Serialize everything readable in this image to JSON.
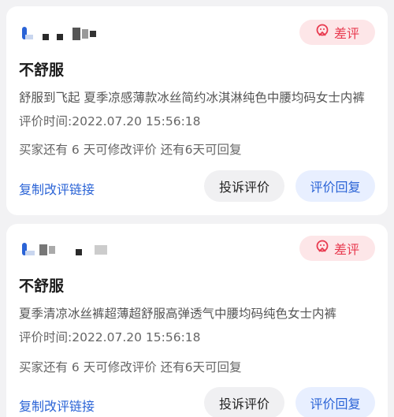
{
  "colors": {
    "accent_blue": "#2a63d6",
    "badge_red": "#e83a4f",
    "badge_bg": "#fde6e8",
    "reply_bg": "#e8efff",
    "complain_bg": "#f0f0f2"
  },
  "reviews": [
    {
      "badge_label": "差评",
      "badge_icon": "thumbs-down-face-icon",
      "title": "不舒服",
      "product": "舒服到飞起 夏季凉感薄款冰丝简约冰淇淋纯色中腰均码女士内裤",
      "time": "评价时间:2022.07.20 15:56:18",
      "notice": "买家还有 6 天可修改评价 还有6天可回复",
      "copy_link": "复制改评链接",
      "complain_button": "投诉评价",
      "reply_button": "评价回复"
    },
    {
      "badge_label": "差评",
      "badge_icon": "thumbs-down-face-icon",
      "title": "不舒服",
      "product": "夏季清凉冰丝裤超薄超舒服高弹透气中腰均码纯色女士内裤",
      "time": "评价时间:2022.07.20 15:56:18",
      "notice": "买家还有 6 天可修改评价 还有6天可回复",
      "copy_link": "复制改评链接",
      "complain_button": "投诉评价",
      "reply_button": "评价回复"
    }
  ]
}
